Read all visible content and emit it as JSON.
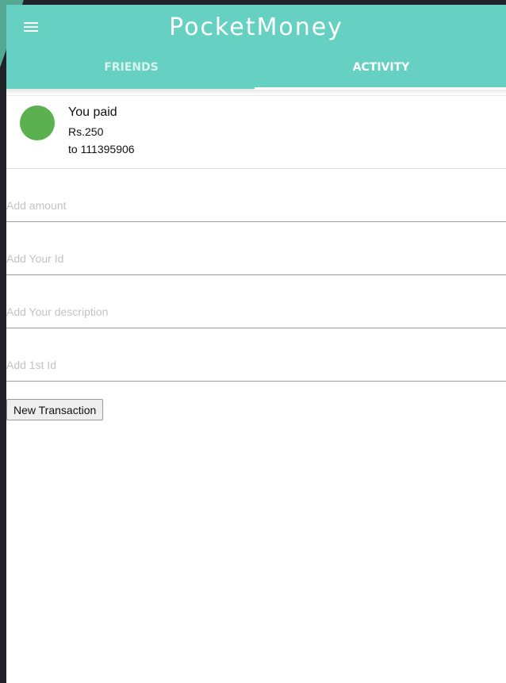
{
  "app": {
    "title": "PocketMoney"
  },
  "tabs": [
    {
      "label": "FRIENDS",
      "active": false
    },
    {
      "label": "ACTIVITY",
      "active": true
    }
  ],
  "activity": [
    {
      "title": "You paid",
      "amount": "Rs.250",
      "recipient": "to 111395906",
      "avatar_color": "#5bb04f"
    }
  ],
  "form": {
    "amount": {
      "placeholder": "Add amount",
      "value": ""
    },
    "your_id": {
      "placeholder": "Add Your Id",
      "value": ""
    },
    "description": {
      "placeholder": "Add Your description",
      "value": ""
    },
    "first_id": {
      "placeholder": "Add 1st Id",
      "value": ""
    },
    "submit_label": "New Transaction"
  },
  "theme": {
    "accent": "#66d1c2",
    "background": "#1f2226"
  }
}
